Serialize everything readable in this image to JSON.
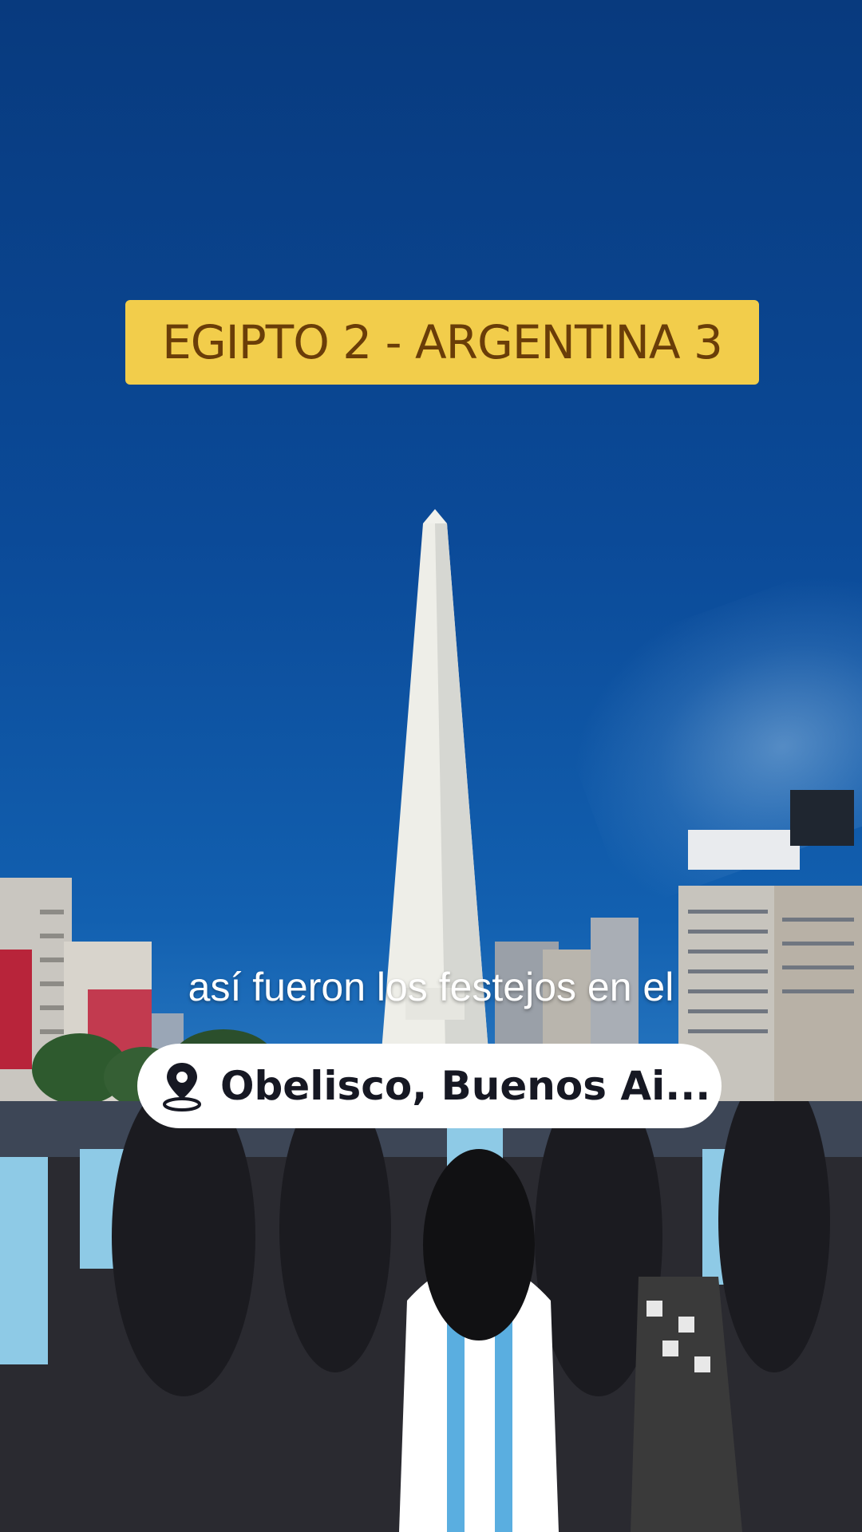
{
  "score_banner": {
    "text": "EGIPTO 2 - ARGENTINA 3",
    "background_color": "#f2cd4b",
    "text_color": "#6a3d08"
  },
  "caption": {
    "text": "así fueron los festejos en el"
  },
  "location_tag": {
    "icon": "location-pin-icon",
    "text": "Obelisco, Buenos Ai..."
  },
  "scene": {
    "sky_color": "#0b4a98",
    "shirt_colors": [
      "#8ecae6",
      "#ffffff"
    ]
  }
}
